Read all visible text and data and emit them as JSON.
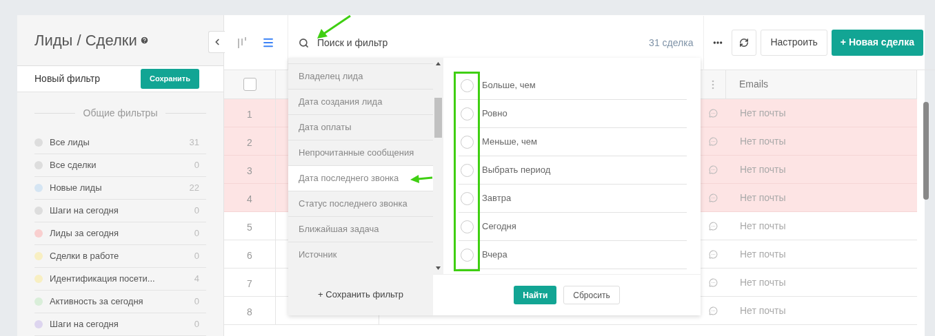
{
  "sidebar": {
    "title": "Лиды / Сделки",
    "filter_name": "Новый фильтр",
    "save_button": "Сохранить",
    "section_title": "Общие фильтры",
    "filters": [
      {
        "label": "Все лиды",
        "count": "31",
        "color": "#dddddd"
      },
      {
        "label": "Все сделки",
        "count": "0",
        "color": "#dddddd"
      },
      {
        "label": "Новые лиды",
        "count": "22",
        "color": "#d5e5f3"
      },
      {
        "label": "Шаги на сегодня",
        "count": "0",
        "color": "#dddddd"
      },
      {
        "label": "Лиды за сегодня",
        "count": "0",
        "color": "#f9cfcf"
      },
      {
        "label": "Сделки в работе",
        "count": "0",
        "color": "#f8efc2"
      },
      {
        "label": "Идентификация посети...",
        "count": "4",
        "color": "#f8efc2"
      },
      {
        "label": "Активность за сегодня",
        "count": "0",
        "color": "#d9eed9"
      },
      {
        "label": "Шаги на сегодня",
        "count": "0",
        "color": "#ddd5ef"
      }
    ]
  },
  "views": [
    {
      "kind": "board",
      "selected": false
    },
    {
      "kind": "list",
      "selected": true
    }
  ],
  "toolbar": {
    "search_placeholder": "Поиск и фильтр",
    "count": "31 сделка",
    "buttons": [
      "Настроить",
      "+ Новая сделка"
    ]
  },
  "table": {
    "select_all_checked": false,
    "email_column": "Emails",
    "rows": [
      {
        "number": "1",
        "highlighted": true,
        "email": "Нет почты"
      },
      {
        "number": "2",
        "highlighted": true,
        "email": "Нет почты"
      },
      {
        "number": "3",
        "highlighted": true,
        "email": "Нет почты"
      },
      {
        "number": "4",
        "highlighted": true,
        "email": "Нет почты"
      },
      {
        "number": "5",
        "highlighted": false,
        "email": "Нет почты"
      },
      {
        "number": "6",
        "highlighted": false,
        "email": "Нет почты"
      },
      {
        "number": "7",
        "highlighted": false,
        "email": "Нет почты"
      },
      {
        "number": "8",
        "highlighted": false,
        "email": "Нет почты"
      }
    ]
  },
  "dropdown": {
    "fields": [
      {
        "label": "Владелец лида",
        "selected": false
      },
      {
        "label": "Дата создания лида",
        "selected": false
      },
      {
        "label": "Дата оплаты",
        "selected": false
      },
      {
        "label": "Непрочитанные сообщения",
        "selected": false
      },
      {
        "label": "Дата последнего звонка",
        "selected": true
      },
      {
        "label": "Статус последнего звонка",
        "selected": false
      },
      {
        "label": "Ближайшая задача",
        "selected": false
      },
      {
        "label": "Источник",
        "selected": false
      }
    ],
    "options": [
      {
        "label": "Больше, чем",
        "checked": false
      },
      {
        "label": "Ровно",
        "checked": false
      },
      {
        "label": "Меньше, чем",
        "checked": false
      },
      {
        "label": "Выбрать период",
        "checked": false
      },
      {
        "label": "Завтра",
        "checked": false
      },
      {
        "label": "Сегодня",
        "checked": false
      },
      {
        "label": "Вчера",
        "checked": false
      }
    ],
    "save_filter": "+ Сохранить фильтр",
    "find_button": "Найти",
    "reset_button": "Сбросить"
  }
}
